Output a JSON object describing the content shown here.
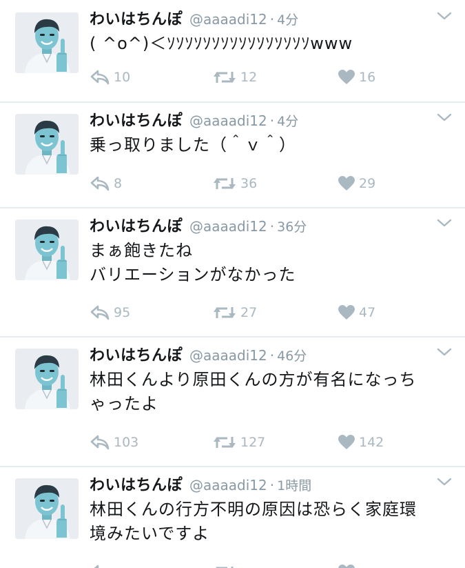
{
  "colors": {
    "text": "#14171a",
    "secondary": "#8899a6",
    "icon": "#aab8c2",
    "divider": "#e6ecf0"
  },
  "icons": {
    "reply": "reply-icon",
    "retweet": "retweet-icon",
    "like": "heart-icon",
    "more": "chevron-down-icon"
  },
  "tweets": [
    {
      "name": "わいはちんぽ",
      "handle": "@aaaadi12",
      "separator": "·",
      "time": "4分",
      "lines": [
        "( ^o^)＜ｿｿｿｿｿｿｿｿｿｿｿｿｿｿｿｿwww"
      ],
      "replies": "10",
      "retweets": "12",
      "likes": "16"
    },
    {
      "name": "わいはちんぽ",
      "handle": "@aaaadi12",
      "separator": "·",
      "time": "4分",
      "lines": [
        "乗っ取りました（＾ｖ＾）"
      ],
      "replies": "8",
      "retweets": "36",
      "likes": "29"
    },
    {
      "name": "わいはちんぽ",
      "handle": "@aaaadi12",
      "separator": "·",
      "time": "36分",
      "lines": [
        "まぁ飽きたね",
        "バリエーションがなかった"
      ],
      "replies": "95",
      "retweets": "27",
      "likes": "47"
    },
    {
      "name": "わいはちんぽ",
      "handle": "@aaaadi12",
      "separator": "·",
      "time": "46分",
      "lines": [
        "林田くんより原田くんの方が有名になっち",
        "ゃったよ"
      ],
      "replies": "103",
      "retweets": "127",
      "likes": "142"
    },
    {
      "name": "わいはちんぽ",
      "handle": "@aaaadi12",
      "separator": "·",
      "time": "1時間",
      "lines": [
        "林田くんの行方不明の原因は恐らく家庭環",
        "境みたいですよ"
      ],
      "replies": "",
      "retweets": "",
      "likes": ""
    }
  ]
}
